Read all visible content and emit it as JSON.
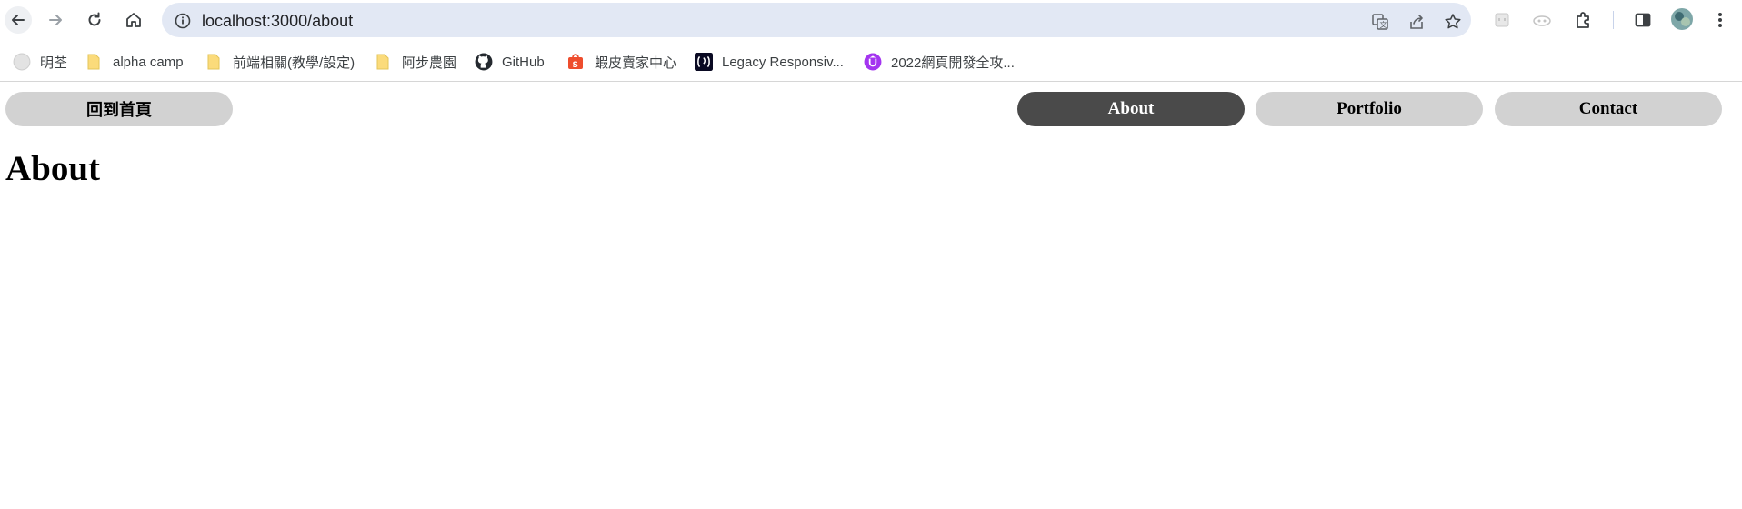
{
  "browser": {
    "url": "localhost:3000/about",
    "bookmarks": [
      {
        "label": "明荃",
        "icon": "globe-icon"
      },
      {
        "label": "alpha camp",
        "icon": "folder-icon"
      },
      {
        "label": "前端相關(教學/設定)",
        "icon": "folder-icon"
      },
      {
        "label": "阿步農園",
        "icon": "folder-icon"
      },
      {
        "label": "GitHub",
        "icon": "github-icon"
      },
      {
        "label": "蝦皮賣家中心",
        "icon": "shopee-icon"
      },
      {
        "label": "Legacy Responsiv...",
        "icon": "freecodecamp-icon"
      },
      {
        "label": "2022網頁開發全攻...",
        "icon": "udemy-icon"
      }
    ]
  },
  "site": {
    "home_label": "回到首頁",
    "nav": [
      {
        "label": "About",
        "active": true
      },
      {
        "label": "Portfolio",
        "active": false
      },
      {
        "label": "Contact",
        "active": false
      }
    ],
    "heading": "About"
  },
  "colors": {
    "nav_active_bg": "#4a4a4a",
    "nav_bg": "#d2d2d2",
    "omnibox_bg": "#e2e8f4",
    "folder": "#f9d86b"
  }
}
